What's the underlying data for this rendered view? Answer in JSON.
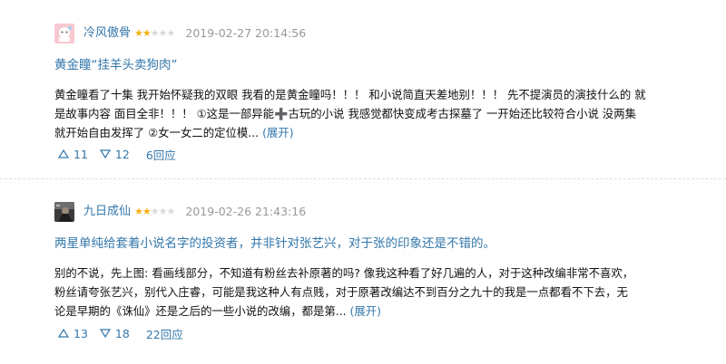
{
  "reviews": [
    {
      "user": "冷风傲骨",
      "rating": 2,
      "rating_max": 5,
      "time": "2019-02-27 20:14:56",
      "title": "黄金瞳“挂羊头卖狗肉”",
      "body_lines": [
        "黄金瞳看了十集 我开始怀疑我的双眼 我看的是黄金瞳吗！！！ 和小说简直天差地别！！！ 先不提演员的演技什么的 就",
        "是故事内容 面目全非！！！ ①这是一部异能➕古玩的小说 我感觉都快变成考古探墓了 一开始还比较符合小说 没两集",
        "就开始自由发挥了 ②女一女二的定位模..."
      ],
      "more": "(展开)",
      "useful": "11",
      "useless": "12",
      "replies": "6回应"
    },
    {
      "user": "九日成仙",
      "rating": 2,
      "rating_max": 5,
      "time": "2019-02-26 21:43:16",
      "title": "两星单纯给套着小说名字的投资者，并非针对张艺兴，对于张的印象还是不错的。",
      "body_lines": [
        "别的不说，先上图: 看画线部分，不知道有粉丝去补原著的吗? 像我这种看了好几遍的人，对于这种改编非常不喜欢，",
        "粉丝请夸张艺兴，别代入庄睿，可能是我这种人有点贱，对于原著改编达不到百分之九十的我是一点都看不下去，无",
        "论是早期的《诛仙》还是之后的一些小说的改编，都是第..."
      ],
      "more": "(展开)",
      "useful": "13",
      "useless": "18",
      "replies": "22回应"
    }
  ],
  "colors": {
    "link": "#3377aa",
    "star": "#f6b10f",
    "star_off": "#d9d9d9",
    "time": "#999999"
  },
  "icons": {
    "useful": "thumb-up-icon",
    "useless": "thumb-down-icon"
  }
}
